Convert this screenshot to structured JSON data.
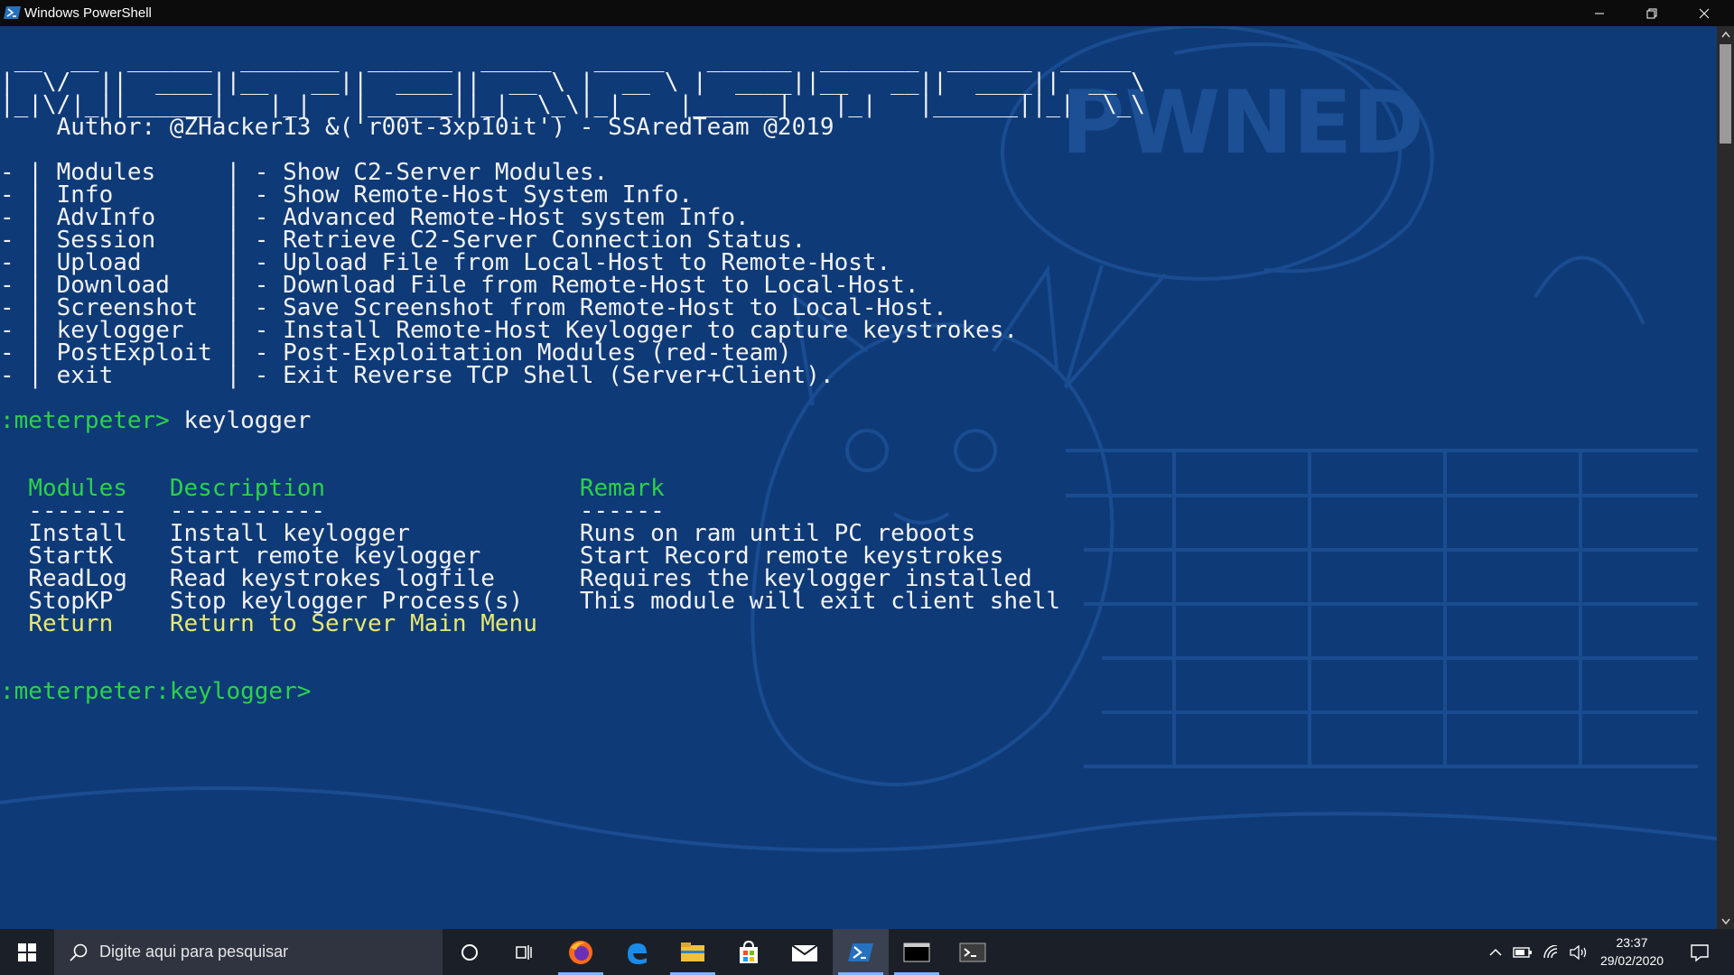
{
  "window": {
    "title": "Windows PowerShell",
    "controls": [
      "minimize-icon",
      "restore-icon",
      "close-icon"
    ]
  },
  "terminal": {
    "banner": [
      " __  __  ______  _______  ______  _____   _____   ______  _______  ______  _____ ",
      "|  \\/  ||  ____||__   __||  ____||  __ \\ |  __ \\ |  ____||__   __||  ____||  __ \\",
      "|_|\\/|_||______|   |_|   |______||_|  \\_\\|_|    |______|   |_|   |______||_|  \\_\\",
      "    Author: @ZHacker13 &('r00t-3xp10it') - SSAredTeam @2019"
    ],
    "menu": [
      {
        "name": "Modules",
        "desc": "Show C2-Server Modules."
      },
      {
        "name": "Info",
        "desc": "Show Remote-Host System Info."
      },
      {
        "name": "AdvInfo",
        "desc": "Advanced Remote-Host system Info."
      },
      {
        "name": "Session",
        "desc": "Retrieve C2-Server Connection Status."
      },
      {
        "name": "Upload",
        "desc": "Upload File from Local-Host to Remote-Host."
      },
      {
        "name": "Download",
        "desc": "Download File from Remote-Host to Local-Host."
      },
      {
        "name": "Screenshot",
        "desc": "Save Screenshot from Remote-Host to Local-Host."
      },
      {
        "name": "keylogger",
        "desc": "Install Remote-Host Keylogger to capture keystrokes."
      },
      {
        "name": "PostExploit",
        "desc": "Post-Exploitation Modules (red-team)"
      },
      {
        "name": "exit",
        "desc": "Exit Reverse TCP Shell (Server+Client)."
      }
    ],
    "prompt1": ":meterpeter> ",
    "command1": "keylogger",
    "table_headers": {
      "modules": "Modules",
      "description": "Description",
      "remark": "Remark"
    },
    "table_underlines": {
      "modules": "-------",
      "description": "-----------",
      "remark": "------"
    },
    "table_rows": [
      {
        "module": "Install",
        "description": "Install keylogger",
        "remark": "Runs on ram until PC reboots"
      },
      {
        "module": "StartK",
        "description": "Start remote keylogger",
        "remark": "Start Record remote keystrokes"
      },
      {
        "module": "ReadLog",
        "description": "Read keystrokes logfile",
        "remark": "Requires the keylogger installed"
      },
      {
        "module": "StopKP",
        "description": "Stop keylogger Process(s)",
        "remark": "This module will exit client shell"
      }
    ],
    "return_row": {
      "module": "Return",
      "description": "Return to Server Main Menu"
    },
    "prompt2": ":meterpeter:keylogger> ",
    "background_text": "PWNED"
  },
  "taskbar": {
    "search_placeholder": "Digite aqui para pesquisar",
    "apps": [
      "cortana-icon",
      "task-view-icon",
      "firefox-icon",
      "edge-icon",
      "file-explorer-icon",
      "store-icon",
      "mail-icon",
      "powershell-icon",
      "cmd-icon",
      "terminal-icon"
    ],
    "time": "23:37",
    "date": "29/02/2020"
  },
  "colors": {
    "console_bg": "#0e3a78",
    "green": "#2bd24a",
    "yellow": "#e8e870",
    "text": "#f2f2f2",
    "taskbar": "#1b2028"
  }
}
